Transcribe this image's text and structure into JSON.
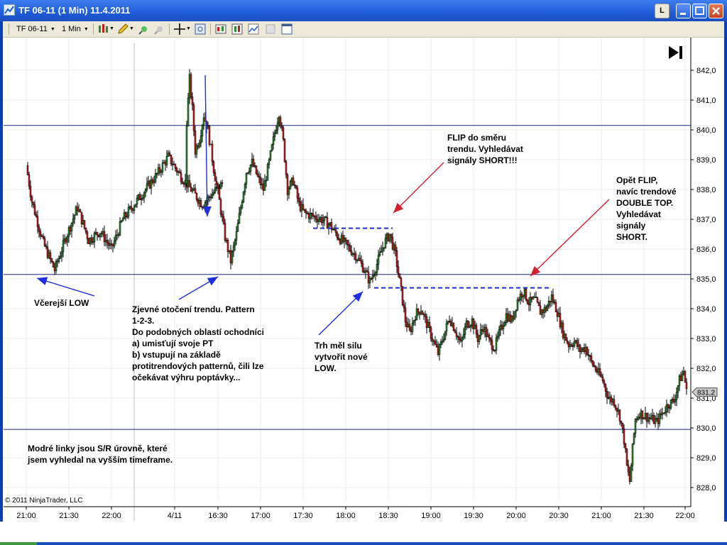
{
  "window": {
    "title": "TF 06-11 (1 Min)  11.4.2011",
    "lock_label": "L"
  },
  "toolbar": {
    "instrument": "TF 06-11",
    "interval": "1 Min",
    "icons": [
      "bar-chart-type-icon",
      "pencil-draw-icon",
      "zoom-in-icon",
      "zoom-out-icon",
      "crosshair-icon",
      "data-box-icon",
      "strategy-icon",
      "indicator-icon",
      "chart-trader-icon",
      "template-icon",
      "properties-icon"
    ]
  },
  "chart_data": {
    "type": "candlestick",
    "instrument": "TF 06-11",
    "bar_interval": "1 Min",
    "y_ticks": [
      "842,0",
      "841,0",
      "840,0",
      "839,0",
      "838,0",
      "837,0",
      "836,0",
      "835,0",
      "834,0",
      "833,0",
      "832,0",
      "831,0",
      "830,0",
      "829,0",
      "828,0"
    ],
    "x_ticks": [
      "21:00",
      "21:30",
      "22:00",
      "4/11",
      "16:30",
      "17:00",
      "17:30",
      "18:00",
      "18:30",
      "19:00",
      "19:30",
      "20:00",
      "20:30",
      "21:00",
      "21:30",
      "22:00"
    ],
    "ylim": [
      827.6,
      842.6
    ],
    "last_price_label": "831,2",
    "last_price": 831.2,
    "sr_lines": [
      840.15,
      835.15,
      829.95
    ],
    "dashed_levels": [
      {
        "from": "17:35",
        "to": "18:30",
        "price": 836.7
      },
      {
        "from": "18:20",
        "to": "20:15",
        "price": 834.7
      }
    ],
    "price_path": [
      [
        "21:00",
        838.8
      ],
      [
        "21:02",
        837.6
      ],
      [
        "21:06",
        836.2
      ],
      [
        "21:10",
        835.3
      ],
      [
        "21:14",
        836.4
      ],
      [
        "21:18",
        837.4
      ],
      [
        "21:22",
        836.3
      ],
      [
        "21:26",
        836.6
      ],
      [
        "21:30",
        836.0
      ],
      [
        "21:34",
        837.0
      ],
      [
        "21:38",
        837.5
      ],
      [
        "21:42",
        838.0
      ],
      [
        "21:46",
        838.5
      ],
      [
        "21:50",
        839.1
      ],
      [
        "21:54",
        838.5
      ],
      [
        "21:58",
        838.0
      ],
      [
        "22:02",
        837.5
      ],
      [
        "22:06",
        837.9
      ],
      [
        "22:09",
        838.2
      ],
      [
        "16:08",
        840.3
      ],
      [
        "16:10",
        841.7
      ],
      [
        "16:12",
        840.7
      ],
      [
        "16:14",
        839.3
      ],
      [
        "16:17",
        839.7
      ],
      [
        "16:20",
        840.5
      ],
      [
        "16:23",
        840.0
      ],
      [
        "16:27",
        838.7
      ],
      [
        "16:31",
        837.6
      ],
      [
        "16:35",
        836.4
      ],
      [
        "16:39",
        835.6
      ],
      [
        "16:43",
        836.5
      ],
      [
        "16:46",
        837.4
      ],
      [
        "16:50",
        838.6
      ],
      [
        "16:54",
        838.9
      ],
      [
        "16:58",
        838.4
      ],
      [
        "17:02",
        838.0
      ],
      [
        "17:06",
        838.9
      ],
      [
        "17:10",
        839.9
      ],
      [
        "17:13",
        840.6
      ],
      [
        "17:16",
        839.6
      ],
      [
        "17:19",
        838.0
      ],
      [
        "17:23",
        838.3
      ],
      [
        "17:27",
        837.5
      ],
      [
        "17:31",
        837.2
      ],
      [
        "17:37",
        837.1
      ],
      [
        "17:43",
        837.0
      ],
      [
        "17:49",
        836.8
      ],
      [
        "17:55",
        836.4
      ],
      [
        "18:01",
        836.1
      ],
      [
        "18:07",
        835.8
      ],
      [
        "18:12",
        835.4
      ],
      [
        "18:17",
        834.9
      ],
      [
        "18:22",
        835.5
      ],
      [
        "18:27",
        836.2
      ],
      [
        "18:31",
        836.5
      ],
      [
        "18:35",
        835.8
      ],
      [
        "18:39",
        834.6
      ],
      [
        "18:42",
        833.6
      ],
      [
        "18:45",
        833.2
      ],
      [
        "18:49",
        833.8
      ],
      [
        "18:53",
        834.0
      ],
      [
        "18:57",
        833.5
      ],
      [
        "19:01",
        833.0
      ],
      [
        "19:05",
        832.5
      ],
      [
        "19:09",
        833.1
      ],
      [
        "19:13",
        833.7
      ],
      [
        "19:17",
        833.3
      ],
      [
        "19:21",
        832.8
      ],
      [
        "19:25",
        833.5
      ],
      [
        "19:29",
        833.6
      ],
      [
        "19:33",
        833.0
      ],
      [
        "19:37",
        833.4
      ],
      [
        "19:41",
        832.9
      ],
      [
        "19:45",
        832.7
      ],
      [
        "19:49",
        833.3
      ],
      [
        "19:53",
        833.8
      ],
      [
        "19:57",
        833.6
      ],
      [
        "20:01",
        834.3
      ],
      [
        "20:05",
        834.6
      ],
      [
        "20:09",
        834.2
      ],
      [
        "20:13",
        834.3
      ],
      [
        "20:17",
        833.9
      ],
      [
        "20:21",
        834.0
      ],
      [
        "20:25",
        834.4
      ],
      [
        "20:29",
        833.9
      ],
      [
        "20:33",
        833.2
      ],
      [
        "20:37",
        832.8
      ],
      [
        "20:41",
        832.9
      ],
      [
        "20:45",
        832.6
      ],
      [
        "20:49",
        832.7
      ],
      [
        "20:53",
        832.2
      ],
      [
        "20:57",
        831.9
      ],
      [
        "21:01",
        831.6
      ],
      [
        "21:05",
        831.0
      ],
      [
        "21:09",
        830.9
      ],
      [
        "21:13",
        830.4
      ],
      [
        "21:16",
        829.6
      ],
      [
        "21:18",
        828.7
      ],
      [
        "21:20",
        828.2
      ],
      [
        "21:22",
        829.3
      ],
      [
        "21:24",
        830.3
      ],
      [
        "21:27",
        830.5
      ],
      [
        "21:31",
        830.4
      ],
      [
        "21:35",
        830.3
      ],
      [
        "21:39",
        830.2
      ],
      [
        "21:43",
        830.5
      ],
      [
        "21:47",
        830.8
      ],
      [
        "21:51",
        830.9
      ],
      [
        "21:55",
        831.6
      ],
      [
        "21:58",
        831.9
      ],
      [
        "22:00",
        831.2
      ]
    ]
  },
  "annotations": {
    "vcerejsi_low": "Včerejší LOW",
    "zjevne_otoceni": "Zjevné otočení trendu. Pattern\n1-2-3.\nDo podobných oblastí ochodníci\na) umisťují svoje PT\nb) vstupují na základě\nprotitrendových patternů, čili lze\nočekávat výhru poptávky...",
    "trh_mel_silu": "Trh měl silu\nvytvořit nové\nLOW.",
    "flip_do_smeru": "FLIP do směru\ntrendu. Vyhledávat\nsignály SHORT!!!",
    "opet_flip": "Opět FLIP,\nnavíc trendové\nDOUBLE TOP.\nVyhledávat\nsignály\nSHORT.",
    "modre_linky": "Modré linky jsou S/R úrovně, které\njsem vyhledal na vyšším timeframe."
  },
  "footer": {
    "copyright": "© 2011 NinjaTrader, LLC"
  },
  "colors": {
    "candle_up": "#2e8b2e",
    "candle_down": "#c81e1e",
    "sr_line": "#1a237e",
    "dashed_level": "#1d2ed8",
    "blue_arrow": "#1f2fe0",
    "red_arrow": "#d42030",
    "titlebar": "#1f5bd9"
  }
}
